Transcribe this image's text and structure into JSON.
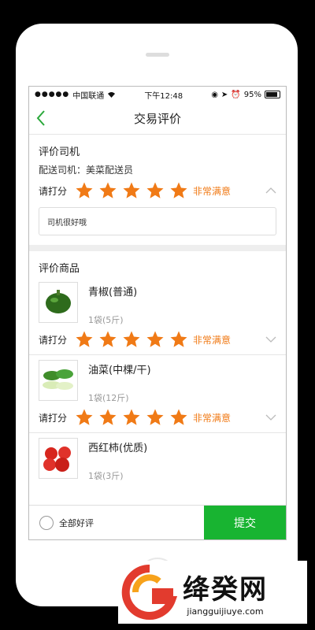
{
  "status_bar": {
    "carrier": "中国联通",
    "time": "下午12:48",
    "battery": "95%"
  },
  "nav": {
    "title": "交易评价"
  },
  "driver_section": {
    "title": "评价司机",
    "driver_label": "配送司机：美菜配送员",
    "rating_label": "请打分",
    "stars": 5,
    "rating_text": "非常满意",
    "comment": "司机很好哦"
  },
  "products_section": {
    "title": "评价商品",
    "items": [
      {
        "name": "青椒(普通)",
        "qty": "1袋(5斤)",
        "rating_label": "请打分",
        "stars": 5,
        "rating_text": "非常满意",
        "icon": "green-pepper-image"
      },
      {
        "name": "油菜(中棵/干)",
        "qty": "1袋(12斤)",
        "rating_label": "请打分",
        "stars": 5,
        "rating_text": "非常满意",
        "icon": "bok-choy-image"
      },
      {
        "name": "西红柿(优质)",
        "qty": "1袋(3斤)",
        "icon": "tomato-image"
      }
    ]
  },
  "bottom_bar": {
    "all_good_label": "全部好评",
    "submit_label": "提交"
  },
  "watermark": {
    "text": "绛癸网",
    "url": "jiangguijiuye.com"
  },
  "colors": {
    "accent_green": "#18b431",
    "star_orange": "#f07a16",
    "back_green": "#2aa83a"
  }
}
